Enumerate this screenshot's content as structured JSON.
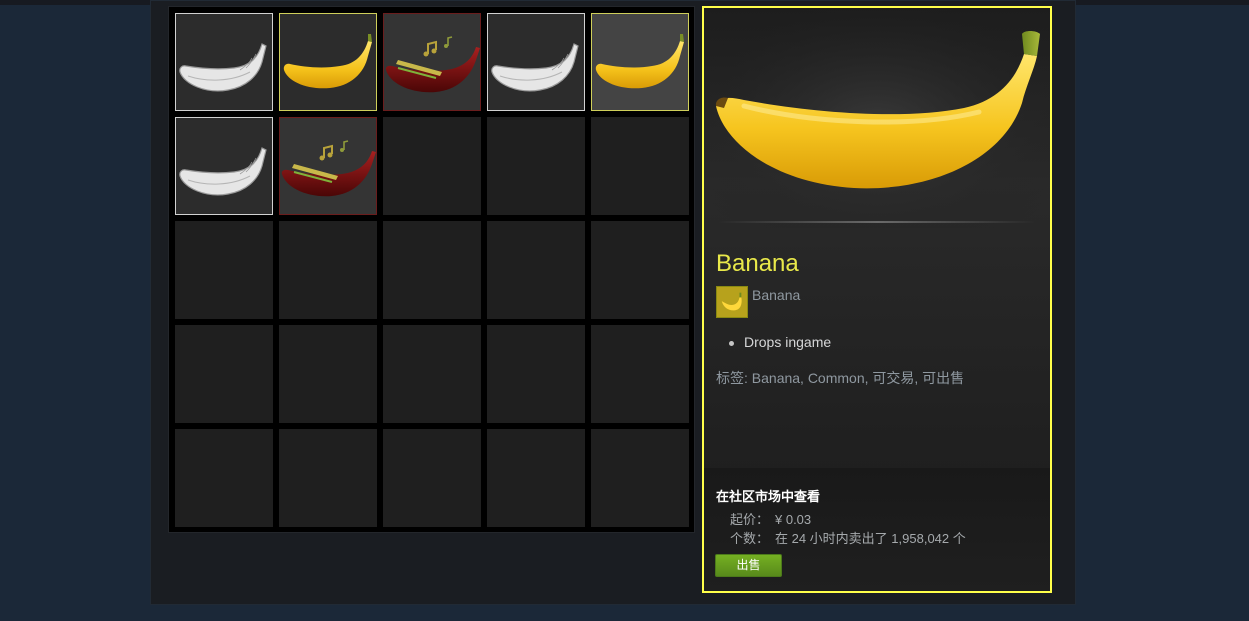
{
  "inventory": {
    "slots": [
      {
        "kind": "grey"
      },
      {
        "kind": "yellow"
      },
      {
        "kind": "music"
      },
      {
        "kind": "grey"
      },
      {
        "kind": "yellow",
        "selected": true
      },
      {
        "kind": "grey"
      },
      {
        "kind": "music"
      },
      {
        "kind": "empty"
      },
      {
        "kind": "empty"
      },
      {
        "kind": "empty"
      },
      {
        "kind": "empty"
      },
      {
        "kind": "empty"
      },
      {
        "kind": "empty"
      },
      {
        "kind": "empty"
      },
      {
        "kind": "empty"
      },
      {
        "kind": "empty"
      },
      {
        "kind": "empty"
      },
      {
        "kind": "empty"
      },
      {
        "kind": "empty"
      },
      {
        "kind": "empty"
      },
      {
        "kind": "empty"
      },
      {
        "kind": "empty"
      },
      {
        "kind": "empty"
      },
      {
        "kind": "empty"
      },
      {
        "kind": "empty"
      }
    ]
  },
  "detail": {
    "item_name": "Banana",
    "game_name": "Banana",
    "descriptions": [
      "Drops ingame"
    ],
    "tags": "标签: Banana, Common, 可交易, 可出售",
    "market": {
      "title": "在社区市场中查看",
      "price_label": "起价：",
      "price_value": "¥ 0.03",
      "count_label": "个数：",
      "count_value": "在 24 小时内卖出了 1,958,042 个",
      "sell_label": "出售"
    }
  },
  "colors": {
    "background": "#1b2838",
    "highlight": "#ffff4a",
    "item_name": "#e9e94a",
    "sell_button": "#75b022"
  }
}
